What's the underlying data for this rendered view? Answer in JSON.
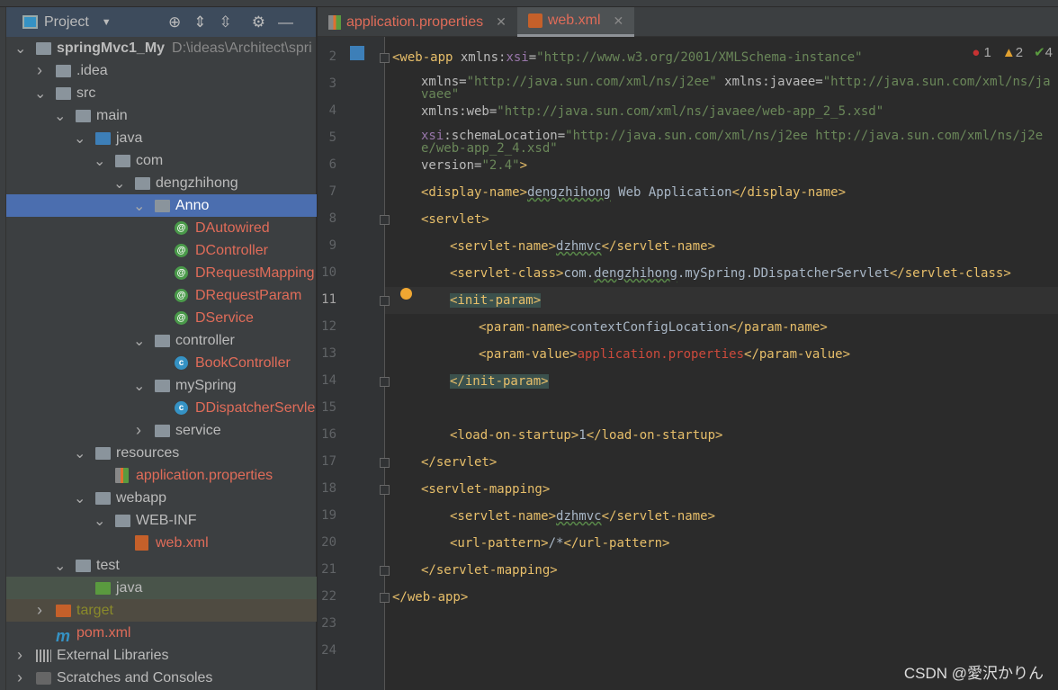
{
  "sidebar": {
    "title": "Project",
    "tools": [
      "locate-icon",
      "expand-all-icon",
      "collapse-all-icon",
      "gear-icon",
      "minimize-icon"
    ],
    "items": [
      {
        "label": "springMvc1_My",
        "path": "D:\\ideas\\Architect\\spri",
        "level": 0,
        "chev": "v",
        "icon": "module",
        "bold": true
      },
      {
        "label": ".idea",
        "level": 1,
        "chev": ">",
        "icon": "folder"
      },
      {
        "label": "src",
        "level": 1,
        "chev": "v",
        "icon": "folder"
      },
      {
        "label": "main",
        "level": 2,
        "chev": "v",
        "icon": "folder"
      },
      {
        "label": "java",
        "level": 3,
        "chev": "v",
        "icon": "folder-blue"
      },
      {
        "label": "com",
        "level": 4,
        "chev": "v",
        "icon": "package"
      },
      {
        "label": "dengzhihong",
        "level": 5,
        "chev": "v",
        "icon": "package"
      },
      {
        "label": "Anno",
        "level": 6,
        "chev": "v",
        "icon": "package",
        "state": "selected"
      },
      {
        "label": "DAutowired",
        "level": 7,
        "icon": "annotation",
        "color": "red"
      },
      {
        "label": "DController",
        "level": 7,
        "icon": "annotation",
        "color": "red"
      },
      {
        "label": "DRequestMapping",
        "level": 7,
        "icon": "annotation",
        "color": "red"
      },
      {
        "label": "DRequestParam",
        "level": 7,
        "icon": "annotation",
        "color": "red"
      },
      {
        "label": "DService",
        "level": 7,
        "icon": "annotation",
        "color": "red"
      },
      {
        "label": "controller",
        "level": 6,
        "chev": "v",
        "icon": "package"
      },
      {
        "label": "BookController",
        "level": 7,
        "icon": "class",
        "color": "red"
      },
      {
        "label": "mySpring",
        "level": 6,
        "chev": "v",
        "icon": "package"
      },
      {
        "label": "DDispatcherServle",
        "level": 7,
        "icon": "class",
        "color": "red"
      },
      {
        "label": "service",
        "level": 6,
        "chev": ">",
        "icon": "package"
      },
      {
        "label": "resources",
        "level": 3,
        "chev": "v",
        "icon": "folder-resources"
      },
      {
        "label": "application.properties",
        "level": 4,
        "icon": "properties",
        "color": "red"
      },
      {
        "label": "webapp",
        "level": 3,
        "chev": "v",
        "icon": "folder-web"
      },
      {
        "label": "WEB-INF",
        "level": 4,
        "chev": "v",
        "icon": "folder"
      },
      {
        "label": "web.xml",
        "level": 5,
        "icon": "xml",
        "color": "red"
      },
      {
        "label": "test",
        "level": 2,
        "chev": "v",
        "icon": "folder"
      },
      {
        "label": "java",
        "level": 3,
        "icon": "folder-green",
        "state": "test"
      },
      {
        "label": "target",
        "level": 1,
        "chev": ">",
        "icon": "folder-orange",
        "state": "excluded",
        "color": "olive"
      },
      {
        "label": "pom.xml",
        "level": 1,
        "icon": "maven",
        "color": "red"
      },
      {
        "label": "External Libraries",
        "level": 0,
        "chev": ">",
        "icon": "libraries"
      },
      {
        "label": "Scratches and Consoles",
        "level": 0,
        "chev": ">",
        "icon": "scratches"
      }
    ]
  },
  "tabs": [
    {
      "label": "application.properties",
      "icon": "properties-icon",
      "active": false
    },
    {
      "label": "web.xml",
      "icon": "xml-icon",
      "active": true
    }
  ],
  "inspections": {
    "errors": "1",
    "warnings": "2",
    "weak_warnings": "4"
  },
  "editor": {
    "current_line": 11,
    "lines": [
      {
        "n": "2",
        "ind": 0,
        "tok": [
          [
            "t",
            "<web-app "
          ],
          [
            "an",
            "xmlns:"
          ],
          [
            "ns",
            "xsi"
          ],
          [
            "an",
            "="
          ],
          [
            "av",
            "\"http://www.w3.org/2001/XMLSchema-instance\""
          ]
        ]
      },
      {
        "n": "3",
        "ind": 1,
        "tok": [
          [
            "an",
            "xmlns="
          ],
          [
            "av",
            "\"http://java.sun.com/xml/ns/j2ee\""
          ],
          [
            "an",
            " xmlns:javaee="
          ],
          [
            "av",
            "\"http://java.sun.com/xml/ns/javaee\""
          ]
        ]
      },
      {
        "n": "4",
        "ind": 1,
        "tok": [
          [
            "an",
            "xmlns:web="
          ],
          [
            "av",
            "\"http://java.sun.com/xml/ns/javaee/web-app_2_5.xsd\""
          ]
        ]
      },
      {
        "n": "5",
        "ind": 1,
        "tok": [
          [
            "ns",
            "xsi"
          ],
          [
            "an",
            ":schemaLocation="
          ],
          [
            "av",
            "\"http://java.sun.com/xml/ns/j2ee http://java.sun.com/xml/ns/j2ee/web-app_2_4.xsd\""
          ]
        ]
      },
      {
        "n": "6",
        "ind": 1,
        "tok": [
          [
            "an",
            "version="
          ],
          [
            "av",
            "\"2.4\""
          ],
          [
            "t",
            ">"
          ]
        ]
      },
      {
        "n": "7",
        "ind": 1,
        "tok": [
          [
            "t",
            "<display-name>"
          ],
          [
            "tx wavy",
            "dengzhihong"
          ],
          [
            "tx",
            " Web Application"
          ],
          [
            "t",
            "</display-name>"
          ]
        ]
      },
      {
        "n": "8",
        "ind": 1,
        "tok": [
          [
            "t",
            "<servlet>"
          ]
        ]
      },
      {
        "n": "9",
        "ind": 2,
        "tok": [
          [
            "t",
            "<servlet-name>"
          ],
          [
            "tx wavy",
            "dzhmvc"
          ],
          [
            "t",
            "</servlet-name>"
          ]
        ]
      },
      {
        "n": "10",
        "ind": 2,
        "tok": [
          [
            "t",
            "<servlet-class>"
          ],
          [
            "tx",
            "com."
          ],
          [
            "tx wavy",
            "dengzhihong"
          ],
          [
            "tx",
            ".mySpring.DDispatcherServlet"
          ],
          [
            "t",
            "</servlet-class>"
          ]
        ]
      },
      {
        "n": "11",
        "ind": 2,
        "tok": [
          [
            "t hl",
            "<init-param>"
          ]
        ]
      },
      {
        "n": "12",
        "ind": 3,
        "tok": [
          [
            "t",
            "<param-name>"
          ],
          [
            "tx",
            "contextConfigLocation"
          ],
          [
            "t",
            "</param-name>"
          ]
        ]
      },
      {
        "n": "13",
        "ind": 3,
        "tok": [
          [
            "t",
            "<param-value>"
          ],
          [
            "rv",
            "application.properties"
          ],
          [
            "t",
            "</param-value>"
          ]
        ]
      },
      {
        "n": "14",
        "ind": 2,
        "tok": [
          [
            "t hl",
            "</init-param>"
          ]
        ]
      },
      {
        "n": "15",
        "ind": 2,
        "tok": []
      },
      {
        "n": "16",
        "ind": 2,
        "tok": [
          [
            "t",
            "<load-on-startup>"
          ],
          [
            "tx",
            "1"
          ],
          [
            "t",
            "</load-on-startup>"
          ]
        ]
      },
      {
        "n": "17",
        "ind": 1,
        "tok": [
          [
            "t",
            "</servlet>"
          ]
        ]
      },
      {
        "n": "18",
        "ind": 1,
        "tok": [
          [
            "t",
            "<servlet-mapping>"
          ]
        ]
      },
      {
        "n": "19",
        "ind": 2,
        "tok": [
          [
            "t",
            "<servlet-name>"
          ],
          [
            "tx wavy",
            "dzhmvc"
          ],
          [
            "t",
            "</servlet-name>"
          ]
        ]
      },
      {
        "n": "20",
        "ind": 2,
        "tok": [
          [
            "t",
            "<url-pattern>"
          ],
          [
            "tx",
            "/*"
          ],
          [
            "t",
            "</url-pattern>"
          ]
        ]
      },
      {
        "n": "21",
        "ind": 1,
        "tok": [
          [
            "t",
            "</servlet-mapping>"
          ]
        ]
      },
      {
        "n": "22",
        "ind": 0,
        "tok": [
          [
            "t",
            "</web-app>"
          ]
        ]
      },
      {
        "n": "23",
        "ind": 0,
        "tok": []
      },
      {
        "n": "24",
        "ind": 0,
        "tok": []
      }
    ],
    "fold_lines": [
      "2",
      "8",
      "11",
      "14",
      "17",
      "18",
      "21",
      "22"
    ]
  },
  "watermark": "CSDN @愛沢かりん"
}
